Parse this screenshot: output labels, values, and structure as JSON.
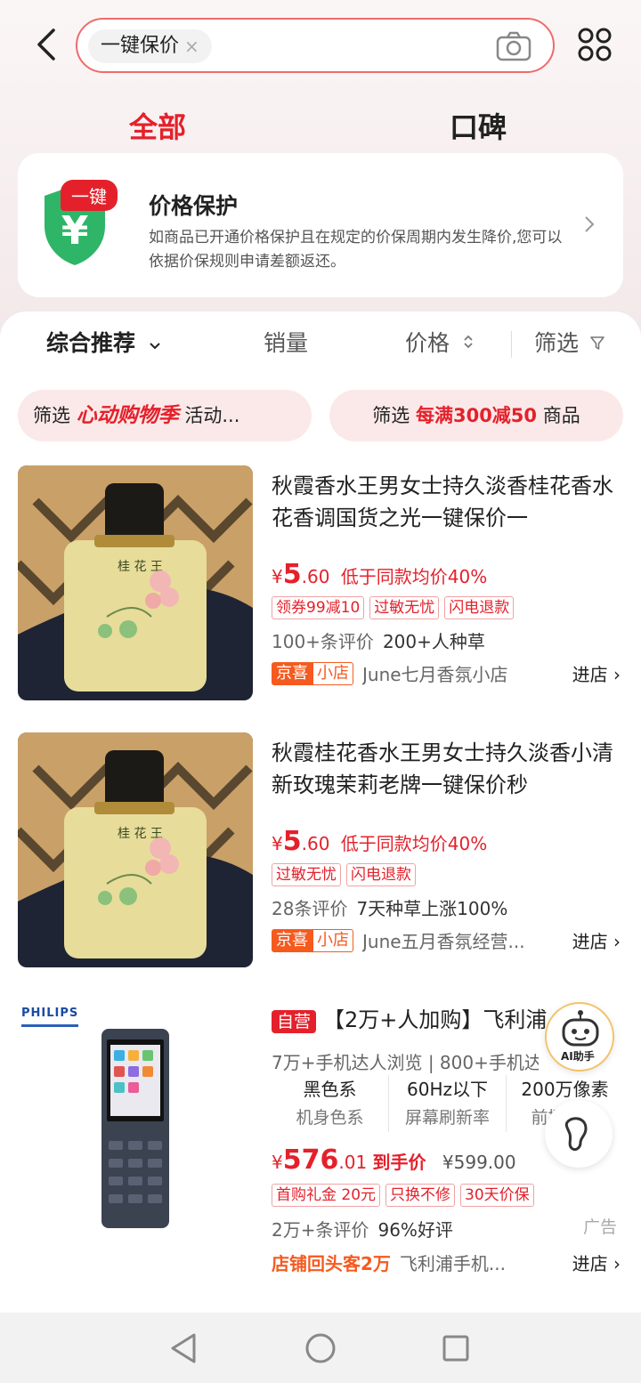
{
  "search": {
    "chip_text": "一键保价",
    "chip_close": "×"
  },
  "tabs": [
    {
      "label": "全部"
    },
    {
      "label": "口碑"
    }
  ],
  "protection_card": {
    "badge": "一键",
    "title": "价格保护",
    "description": "如商品已开通价格保护且在规定的价保周期内发生降价,您可以依据价保规则申请差额返还。"
  },
  "sort_bar": {
    "comprehensive": "综合推荐",
    "sales": "销量",
    "price": "价格",
    "filter": "筛选"
  },
  "filter_pills": [
    {
      "prefix": "筛选",
      "highlight": "心动购物季",
      "suffix": "活动..."
    },
    {
      "prefix": "筛选",
      "highlight": "每满300减50",
      "suffix": "商品"
    }
  ],
  "products": [
    {
      "title": "秋霞香水王男女士持久淡香桂花香水花香调国货之光一键保价一",
      "currency": "¥",
      "price_main": "5",
      "price_dec": ".60",
      "price_note": "低于同款均价40%",
      "tags": [
        "领券99减10",
        "过敏无忧",
        "闪电退款"
      ],
      "reviews": "100+条评价",
      "extra_stat": "200+人种草",
      "shop_badge_1": "京喜",
      "shop_badge_2": "小店",
      "shop_name": "June七月香氛小店",
      "go_shop": "进店 ›"
    },
    {
      "title": "秋霞桂花香水王男女士持久淡香小清新玫瑰茉莉老牌一键保价秒",
      "currency": "¥",
      "price_main": "5",
      "price_dec": ".60",
      "price_note": "低于同款均价40%",
      "tags": [
        "过敏无忧",
        "闪电退款"
      ],
      "reviews": "28条评价",
      "extra_stat": "7天种草上涨100%",
      "shop_badge_1": "京喜",
      "shop_badge_2": "小店",
      "shop_name": "June五月香氛经营...",
      "go_shop": "进店 ›"
    },
    {
      "brand_logo": "PHILIPS",
      "self_operated": "自营",
      "title": "【2万+人加购】飞利浦",
      "browse_info": "7万+手机达人浏览 | 800+手机达人关",
      "specs": [
        {
          "value": "黑色系",
          "label": "机身色系"
        },
        {
          "value": "60Hz以下",
          "label": "屏幕刷新率"
        },
        {
          "value": "200万像素",
          "label": "前摄主摄"
        }
      ],
      "currency": "¥",
      "price_main": "576",
      "price_dec": ".01",
      "price_note": "到手价",
      "original_price": "¥599.00",
      "tags": [
        "首购礼金 20元",
        "只换不修",
        "30天价保"
      ],
      "reviews": "2万+条评价",
      "extra_stat": "96%好评",
      "ad_label": "广告",
      "shop_promo": "店铺回头客2万",
      "shop_name": "飞利浦手机...",
      "go_shop": "进店 ›"
    }
  ],
  "ai_assistant": {
    "label": "AI助手"
  },
  "colors": {
    "accent": "#e4212b",
    "orange": "#f55a1f",
    "pill_bg": "#fbe9e9"
  }
}
